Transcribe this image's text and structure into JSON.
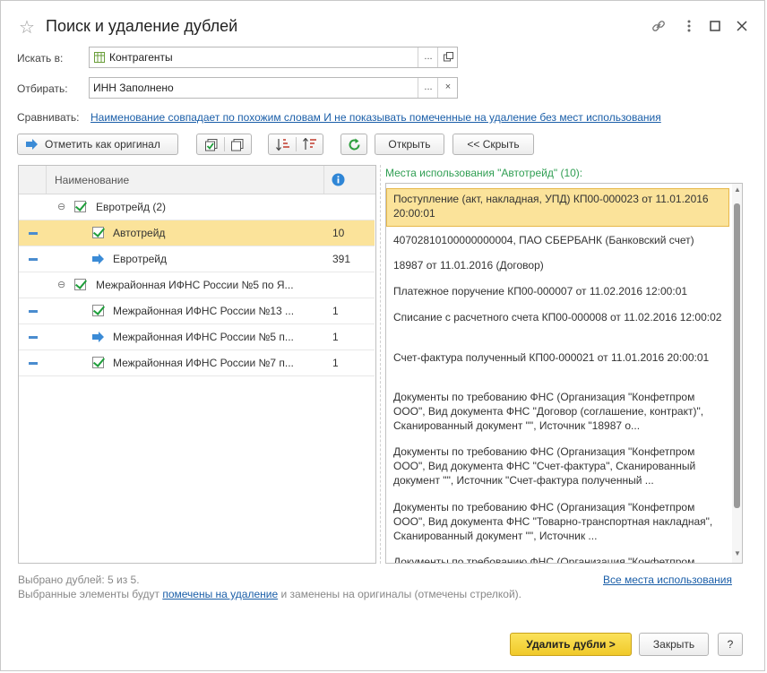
{
  "window": {
    "title": "Поиск и удаление дублей"
  },
  "form": {
    "search_label": "Искать в:",
    "search_value": "Контрагенты",
    "filter_label": "Отбирать:",
    "filter_value": "ИНН Заполнено",
    "compare_label": "Сравнивать:",
    "compare_link": "Наименование совпадает по похожим словам И не показывать помеченные на удаление без мест использования",
    "ellipsis": "...",
    "clear": "×"
  },
  "toolbar": {
    "mark_original": "Отметить как оригинал",
    "open": "Открыть",
    "hide": "<< Скрыть"
  },
  "tree": {
    "column_name": "Наименование",
    "rows": [
      {
        "name": "Евротрейд (2)",
        "value": ""
      },
      {
        "name": "Автотрейд",
        "value": "10"
      },
      {
        "name": "Евротрейд",
        "value": "391"
      },
      {
        "name": "Межрайонная ИФНС России №5 по Я...",
        "value": ""
      },
      {
        "name": "Межрайонная ИФНС России №13 ...",
        "value": "1"
      },
      {
        "name": "Межрайонная ИФНС России №5 п...",
        "value": "1"
      },
      {
        "name": "Межрайонная ИФНС России №7 п...",
        "value": "1"
      }
    ]
  },
  "usage": {
    "header": "Места использования \"Автотрейд\" (10):",
    "items": [
      "Поступление (акт, накладная, УПД) КП00-000023 от 11.01.2016 20:00:01",
      "40702810100000000004, ПАО СБЕРБАНК (Банковский счет)",
      "18987 от 11.01.2016 (Договор)",
      "Платежное поручение КП00-000007 от 11.02.2016 12:00:01",
      "Списание с расчетного счета КП00-000008 от 11.02.2016 12:00:02",
      "Счет-фактура полученный КП00-000021 от 11.01.2016 20:00:01",
      "Документы по требованию ФНС (Организация \"Конфетпром ООО\", Вид документа ФНС \"Договор (соглашение, контракт)\", Сканированный документ \"\", Источник \"18987 о...",
      "Документы по требованию ФНС (Организация \"Конфетпром ООО\", Вид документа ФНС \"Счет-фактура\", Сканированный документ \"\", Источник \"Счет-фактура полученный ...",
      "Документы по требованию ФНС (Организация \"Конфетпром ООО\", Вид документа ФНС \"Товарно-транспортная накладная\", Сканированный документ \"\", Источник ...",
      "Документы по требованию ФНС (Организация \"Конфетпром"
    ]
  },
  "footer": {
    "selected": "Выбрано дублей: 5 из 5.",
    "note_before": "Выбранные элементы будут ",
    "note_link": "помечены на удаление",
    "note_after": " и заменены на оригиналы (отмечены стрелкой).",
    "all_usages": "Все места использования",
    "delete": "Удалить дубли >",
    "close": "Закрыть",
    "help": "?"
  },
  "colors": {
    "accent": "#f5d33a",
    "selection": "#fbe39a",
    "link": "#1a5ea8",
    "check": "#1e9e3a",
    "arrow": "#3b8bd6"
  },
  "icons": [
    "star-icon",
    "link-icon",
    "minimize-icon",
    "maximize-icon",
    "close-icon",
    "table-icon",
    "pick-icon",
    "clear-icon",
    "arrow-right-icon",
    "check-all-icon",
    "uncheck-all-icon",
    "sort-asc-icon",
    "sort-desc-icon",
    "refresh-icon",
    "info-icon",
    "collapse-icon"
  ]
}
